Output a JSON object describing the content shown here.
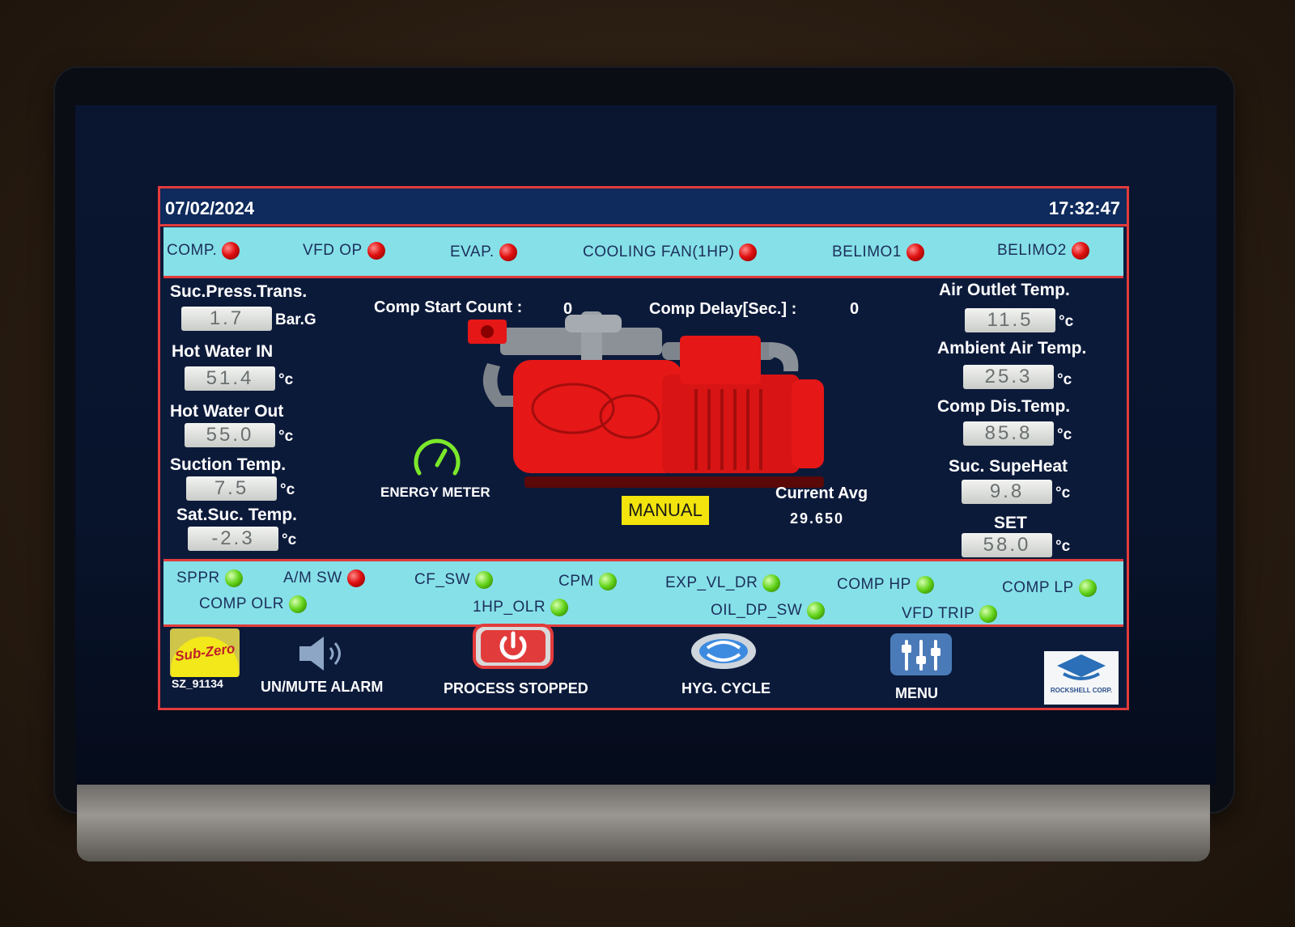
{
  "header": {
    "date": "07/02/2024",
    "time": "17:32:47"
  },
  "status_top": [
    {
      "label": "COMP.",
      "state": "red"
    },
    {
      "label": "VFD OP",
      "state": "red"
    },
    {
      "label": "EVAP.",
      "state": "red"
    },
    {
      "label": "COOLING FAN(1HP)",
      "state": "red"
    },
    {
      "label": "BELIMO1",
      "state": "red"
    },
    {
      "label": "BELIMO2",
      "state": "red"
    }
  ],
  "left_readings": [
    {
      "label": "Suc.Press.Trans.",
      "value": "1.7",
      "unit": "Bar.G"
    },
    {
      "label": "Hot Water IN",
      "value": "51.4",
      "unit": "°c"
    },
    {
      "label": "Hot Water Out",
      "value": "55.0",
      "unit": "°c"
    },
    {
      "label": "Suction Temp.",
      "value": "7.5",
      "unit": "°c"
    },
    {
      "label": "Sat.Suc. Temp.",
      "value": "-2.3",
      "unit": "°c"
    }
  ],
  "right_readings": [
    {
      "label": "Air Outlet Temp.",
      "value": "11.5",
      "unit": "°c"
    },
    {
      "label": "Ambient Air Temp.",
      "value": "25.3",
      "unit": "°c"
    },
    {
      "label": "Comp Dis.Temp.",
      "value": "85.8",
      "unit": "°c"
    },
    {
      "label": "Suc. SupeHeat",
      "value": "9.8",
      "unit": "°c"
    },
    {
      "label": "SET",
      "value": "58.0",
      "unit": "°c"
    }
  ],
  "center": {
    "comp_start_label": "Comp Start Count :",
    "comp_start_value": "0",
    "comp_delay_label": "Comp Delay[Sec.] :",
    "comp_delay_value": "0",
    "energy_meter_label": "ENERGY METER",
    "mode_badge": "MANUAL",
    "current_avg_label": "Current Avg",
    "current_avg_value": "29.650"
  },
  "status_bottom": [
    {
      "label": "SPPR",
      "state": "green"
    },
    {
      "label": "A/M SW",
      "state": "red"
    },
    {
      "label": "CF_SW",
      "state": "green"
    },
    {
      "label": "CPM",
      "state": "green"
    },
    {
      "label": "EXP_VL_DR",
      "state": "green"
    },
    {
      "label": "COMP HP",
      "state": "green"
    },
    {
      "label": "COMP LP",
      "state": "green"
    },
    {
      "label": "COMP OLR",
      "state": "green"
    },
    {
      "label": "1HP_OLR",
      "state": "green"
    },
    {
      "label": "OIL_DP_SW",
      "state": "green"
    },
    {
      "label": "VFD TRIP",
      "state": "green"
    }
  ],
  "nav": {
    "logo_text": "Sub-Zero",
    "device_id": "SZ_91134",
    "mute_label": "UN/MUTE ALARM",
    "process_label": "PROCESS STOPPED",
    "hyg_label": "HYG. CYCLE",
    "menu_label": "MENU",
    "brand_text": "ROCKSHELL CORP."
  },
  "colors": {
    "border": "#e23b3b",
    "status_bg": "#86e0e8",
    "compressor": "#e51717",
    "badge": "#f2e40c"
  }
}
